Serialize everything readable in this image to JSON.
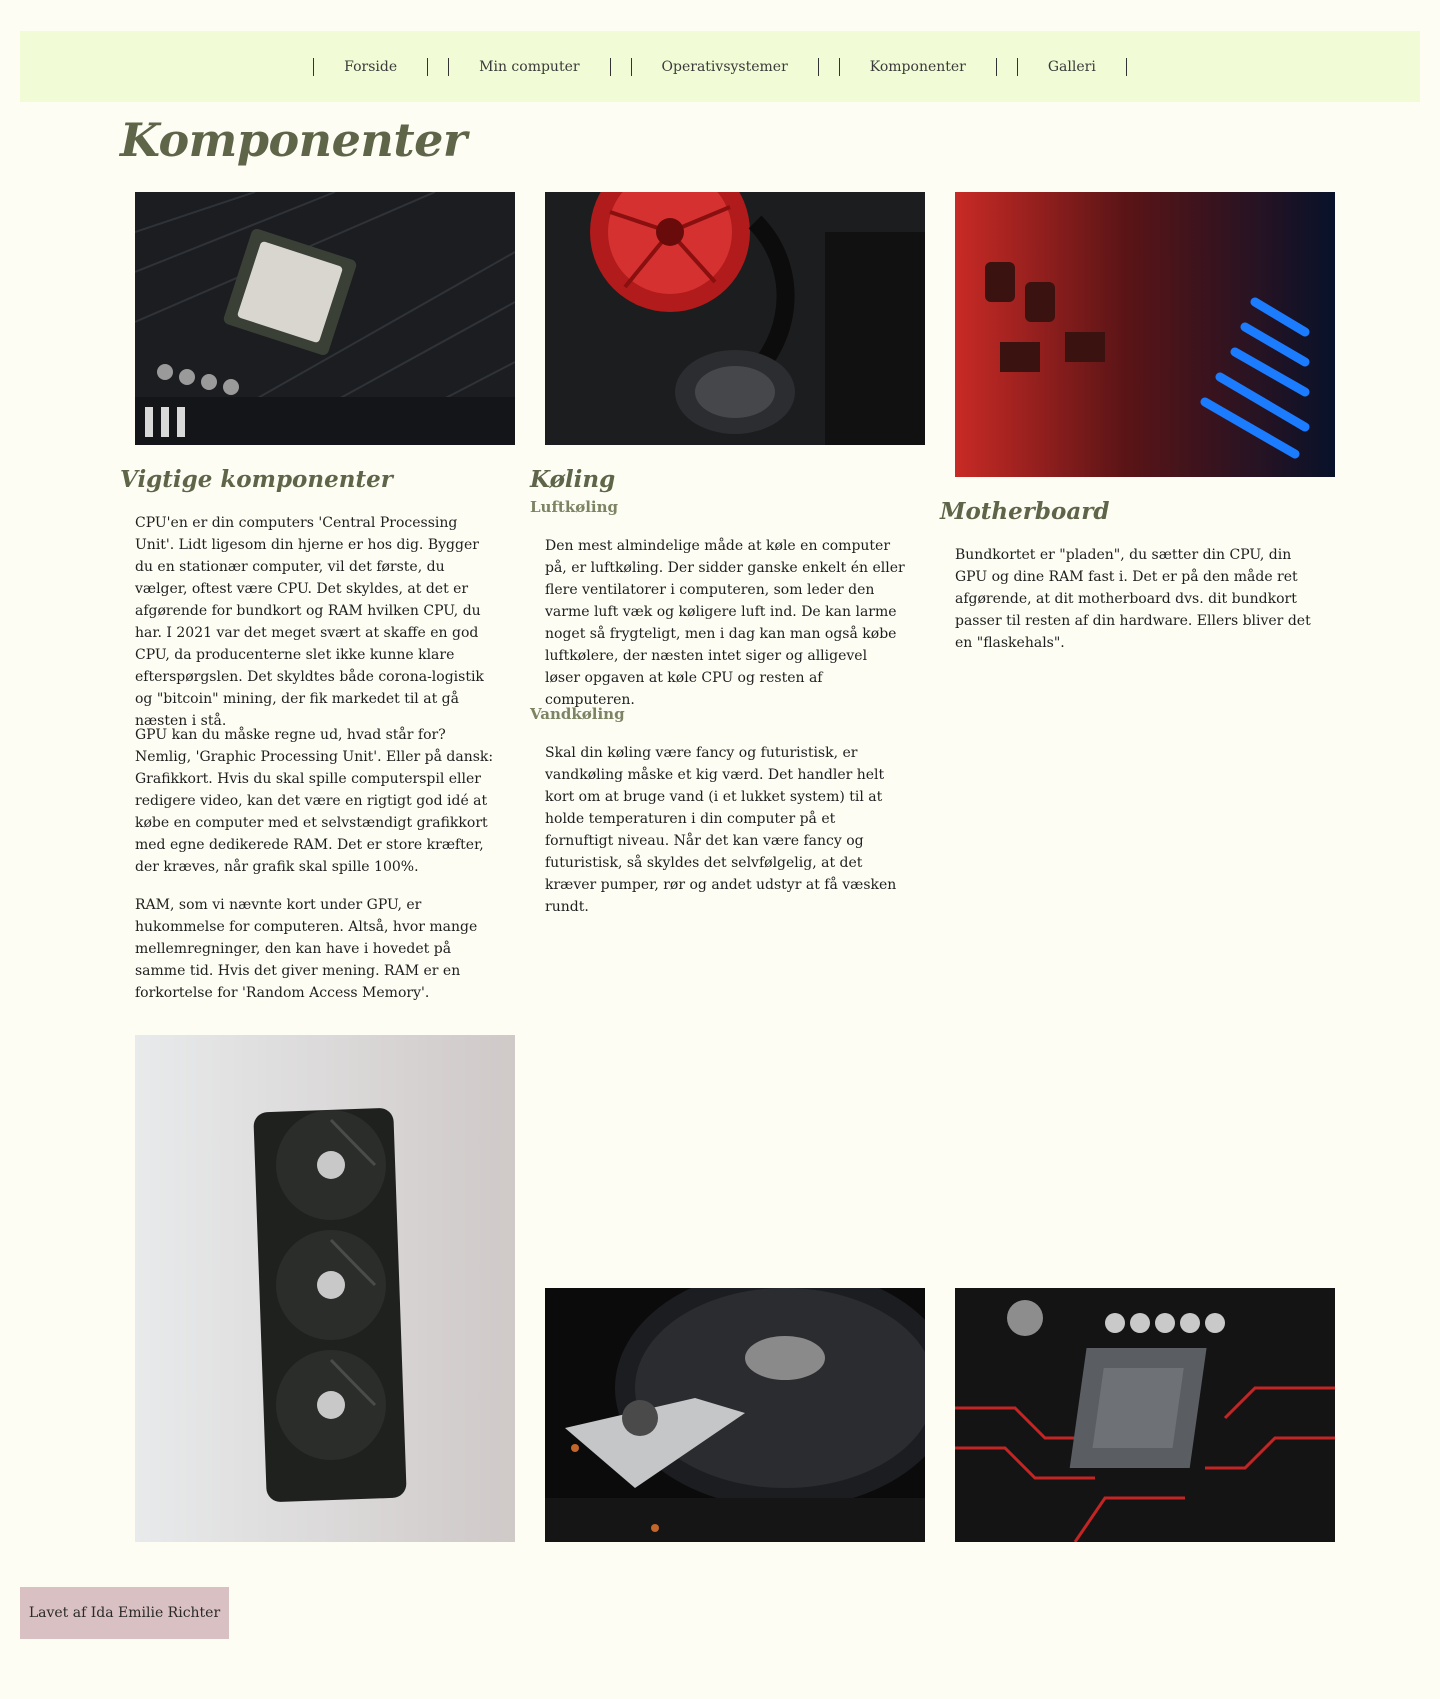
{
  "nav": {
    "items": [
      "Forside",
      "Min computer",
      "Operativsystemer",
      "Komponenter",
      "Galleri"
    ]
  },
  "page_title": "Komponenter",
  "sections": {
    "vigtige": {
      "title": "Vigtige komponenter",
      "paragraphs": [
        "CPU'en er din computers 'Central Processing Unit'. Lidt ligesom din hjerne er hos dig. Bygger du en stationær computer, vil det første, du vælger, oftest være CPU. Det skyldes, at det er afgørende for bundkort og RAM hvilken CPU, du har. I 2021 var det meget svært at skaffe en god CPU, da producenterne slet ikke kunne klare efterspørgslen. Det skyldtes både corona-logistik og \"bitcoin\" mining, der fik markedet til at gå næsten i stå.",
        "GPU kan du måske regne ud, hvad står for? Nemlig, 'Graphic Processing Unit'. Eller på dansk: Grafikkort. Hvis du skal spille computerspil eller redigere video, kan det være en rigtigt god idé at købe en computer med et selvstændigt grafikkort med egne dedikerede RAM. Det er store kræfter, der kræves, når grafik skal spille 100%.",
        "RAM, som vi nævnte kort under GPU, er hukommelse for computeren. Altså, hvor mange mellemregninger, den kan have i hovedet på samme tid. Hvis det giver mening. RAM er en forkortelse for 'Random Access Memory'."
      ]
    },
    "koeling": {
      "title": "Køling",
      "sub1": "Luftkøling",
      "para1": "Den mest almindelige måde at køle en computer på, er luftkøling. Der sidder ganske enkelt én eller flere ventilatorer i computeren, som leder den varme luft væk og køligere luft ind. De kan larme noget så frygteligt, men i dag kan man også købe luftkølere, der næsten intet siger og alligevel løser opgaven at køle CPU og resten af computeren.",
      "sub2": "Vandkøling",
      "para2": "Skal din køling være fancy og futuristisk, er vandkøling måske et kig værd. Det handler helt kort om at bruge vand (i et lukket system) til at holde temperaturen i din computer på et fornuftigt niveau. Når det kan være fancy og futuristisk, så skyldes det selvfølgelig, at det kræver pumper, rør og andet udstyr at få væsken rundt."
    },
    "motherboard": {
      "title": "Motherboard",
      "para": "Bundkortet er \"pladen\", du sætter din CPU, din GPU og dine RAM fast i. Det er på den måde ret afgørende, at dit motherboard dvs. dit bundkort passer til resten af din hardware. Ellers bliver det en \"flaskehals\"."
    }
  },
  "images": {
    "cpu": "cpu-image",
    "cooler": "cooler-image",
    "motherboard": "motherboard-image",
    "gpu": "gpu-image",
    "harddisk": "harddisk-image",
    "socket": "socket-image"
  },
  "colors": {
    "background": "#fdfdf4",
    "nav_bg": "#f1fcd6",
    "heading": "#5f6549",
    "subheading": "#7c8463",
    "footer_bg": "#d9c0c2"
  },
  "footer": {
    "text": "Lavet af Ida Emilie Richter"
  }
}
